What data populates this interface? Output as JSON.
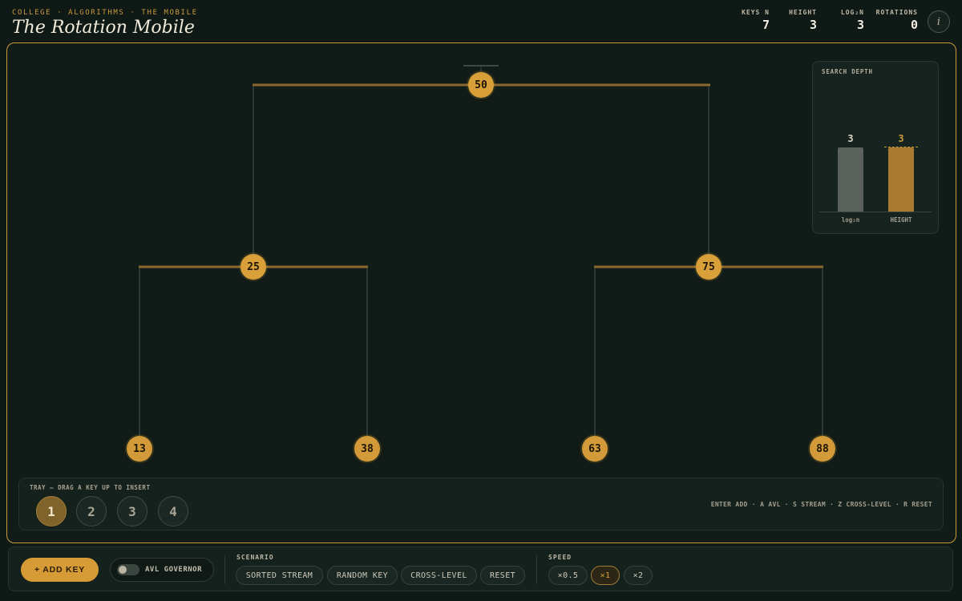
{
  "header": {
    "breadcrumb": "COLLEGE · ALGORITHMS · THE MOBILE",
    "title": "The Rotation Mobile",
    "stats": [
      {
        "label": "KEYS N",
        "value": "7"
      },
      {
        "label": "HEIGHT",
        "value": "3"
      },
      {
        "label": "LOG₂N",
        "value": "3"
      },
      {
        "label": "ROTATIONS",
        "value": "0"
      }
    ],
    "info_icon": "i"
  },
  "tree": {
    "root": "50",
    "level1": [
      "25",
      "75"
    ],
    "level2": [
      "13",
      "38",
      "63",
      "88"
    ]
  },
  "depth_panel": {
    "title": "SEARCH DEPTH",
    "bars": [
      {
        "label": "log₂n",
        "value": "3",
        "color": "#5b625d"
      },
      {
        "label": "HEIGHT",
        "value": "3",
        "color": "#a97a30"
      }
    ]
  },
  "tray": {
    "label": "TRAY — DRAG A KEY UP TO INSERT",
    "keys": [
      "1",
      "2",
      "3",
      "4"
    ],
    "active_key_index": 0,
    "shortcuts": "ENTER ADD · A AVL · S STREAM · Z CROSS-LEVEL · R RESET"
  },
  "controls": {
    "add_key": "+ ADD KEY",
    "avl_governor": "AVL GOVERNOR",
    "avl_on": false,
    "scenario_title": "SCENARIO",
    "scenarios": [
      "SORTED STREAM",
      "RANDOM KEY",
      "CROSS-LEVEL",
      "RESET"
    ],
    "speed_title": "SPEED",
    "speeds": [
      "×0.5",
      "×1",
      "×2"
    ],
    "active_speed": "×1"
  },
  "colors": {
    "accent": "#c99a3e",
    "node": "#d9a03a",
    "background": "#0f1a16"
  }
}
